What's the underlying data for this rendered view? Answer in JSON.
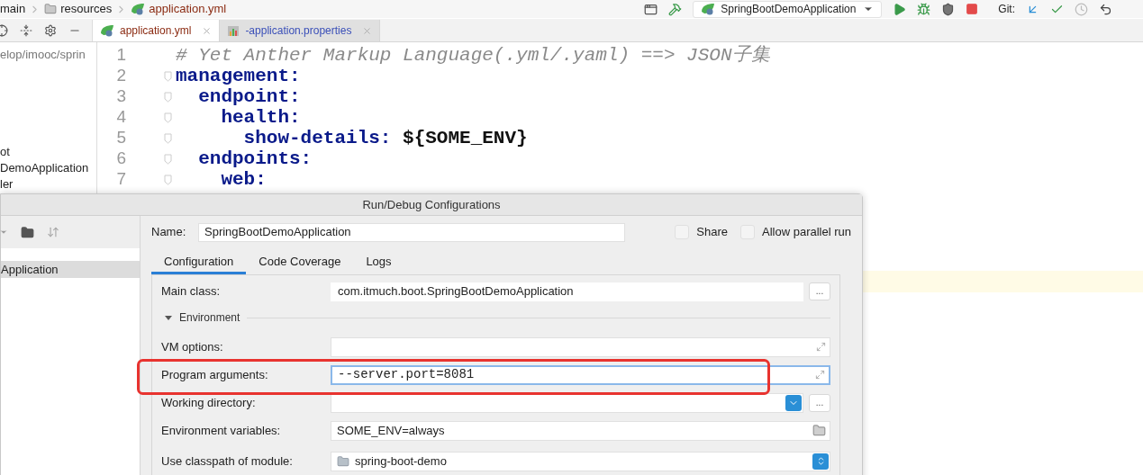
{
  "breadcrumb": [
    {
      "label": "main",
      "kind": "plain"
    },
    {
      "label": "resources",
      "kind": "folder"
    },
    {
      "label": "application.yml",
      "kind": "yaml"
    }
  ],
  "toolbar": {
    "run_config": "SpringBootDemoApplication",
    "git_label": "Git:"
  },
  "editor_tabs": [
    {
      "label": "application.yml",
      "kind": "yaml",
      "selected": true
    },
    {
      "label": "-application.properties",
      "kind": "properties",
      "selected": false
    }
  ],
  "project_tree": [
    "elop/imooc/sprin",
    "ot",
    "DemoApplication",
    "ler"
  ],
  "editor": {
    "lines": [
      {
        "number": "1",
        "segments": [
          {
            "kind": "comment",
            "text": "# Yet Anther Markup Language(.yml/.yaml) ==> JSON子集"
          }
        ]
      },
      {
        "number": "2",
        "segments": [
          {
            "kind": "key",
            "text": "management:"
          }
        ]
      },
      {
        "number": "3",
        "segments": [
          {
            "kind": "key",
            "text": "  endpoint:"
          }
        ]
      },
      {
        "number": "4",
        "segments": [
          {
            "kind": "key",
            "text": "    health:"
          }
        ]
      },
      {
        "number": "5",
        "segments": [
          {
            "kind": "key",
            "text": "      show-details:"
          },
          {
            "kind": "value",
            "text": " ${SOME_ENV}"
          }
        ]
      },
      {
        "number": "6",
        "segments": [
          {
            "kind": "key",
            "text": "  endpoints:"
          }
        ]
      },
      {
        "number": "7",
        "segments": [
          {
            "kind": "key",
            "text": "    web:"
          }
        ]
      }
    ]
  },
  "dialog": {
    "title": "Run/Debug Configurations",
    "config_list": [
      {
        "label": "Application",
        "selected": true
      }
    ],
    "name_label": "Name:",
    "name_value": "SpringBootDemoApplication",
    "options": [
      {
        "label": "Share",
        "checked": false
      },
      {
        "label": "Allow parallel run",
        "checked": false
      }
    ],
    "tabs": [
      {
        "label": "Configuration",
        "selected": true
      },
      {
        "label": "Code Coverage",
        "selected": false
      },
      {
        "label": "Logs",
        "selected": false
      }
    ],
    "main_class": {
      "label": "Main class:",
      "value": "com.itmuch.boot.SpringBootDemoApplication",
      "button": "..."
    },
    "section": {
      "label": "Environment",
      "expanded": true
    },
    "fields": [
      {
        "label": "VM options:",
        "kind": "expand",
        "focused": false
      },
      {
        "label": "Program arguments:",
        "kind": "expand",
        "value": "--server.port=8081",
        "focused": true
      },
      {
        "label": "Working directory:",
        "kind": "dropdown",
        "button": "...",
        "focused": false
      },
      {
        "label": "Environment variables:",
        "kind": "folder",
        "value": "SOME_ENV=always",
        "focused": false
      },
      {
        "label": "Use classpath of module:",
        "kind": "module",
        "value": "spring-boot-demo",
        "focused": false
      }
    ]
  }
}
